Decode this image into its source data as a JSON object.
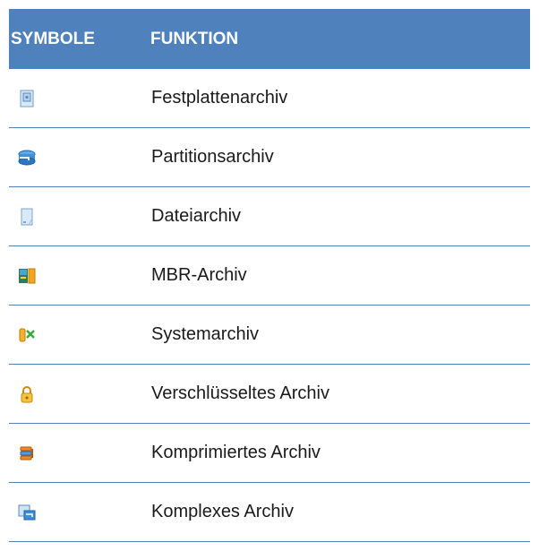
{
  "table": {
    "headers": [
      "SYMBOLE",
      "FUNKTION"
    ],
    "rows": [
      {
        "icon": "disk-archive-icon",
        "label": "Festplattenarchiv"
      },
      {
        "icon": "partition-archive-icon",
        "label": "Partitionsarchiv"
      },
      {
        "icon": "file-archive-icon",
        "label": "Dateiarchiv"
      },
      {
        "icon": "mbr-archive-icon",
        "label": "MBR-Archiv"
      },
      {
        "icon": "system-archive-icon",
        "label": "Systemarchiv"
      },
      {
        "icon": "lock-icon",
        "label": "Verschlüsseltes Archiv"
      },
      {
        "icon": "compressed-archive-icon",
        "label": "Komprimiertes Archiv"
      },
      {
        "icon": "complex-archive-icon",
        "label": "Komplexes Archiv"
      }
    ]
  },
  "colors": {
    "header_bg": "#4f81bd",
    "header_text": "#ffffff",
    "row_border": "#4f81bd"
  }
}
